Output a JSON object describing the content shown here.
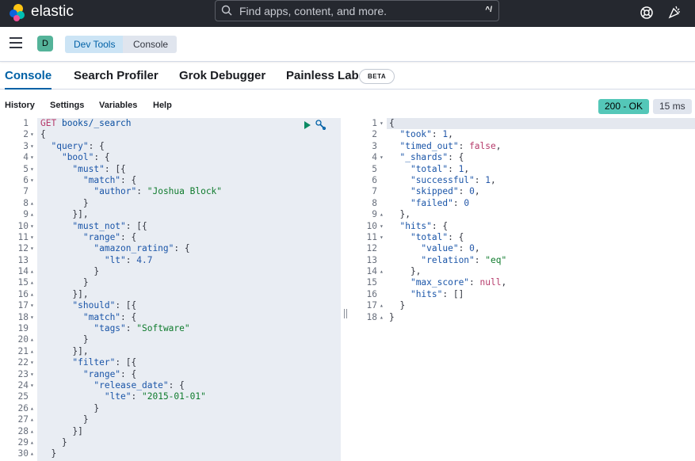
{
  "header": {
    "brand": "elastic",
    "search_placeholder": "Find apps, content, and more.",
    "search_shortcut": "^/"
  },
  "subheader": {
    "avatar_initial": "D",
    "breadcrumbs": [
      "Dev Tools",
      "Console"
    ]
  },
  "tabs": {
    "console": "Console",
    "profiler": "Search Profiler",
    "grok": "Grok Debugger",
    "painless": "Painless Lab",
    "beta": "BETA"
  },
  "toolbar": {
    "history": "History",
    "settings": "Settings",
    "variables": "Variables",
    "help": "Help",
    "status": "200 - OK",
    "time": "15 ms"
  },
  "editor_lines": [
    {
      "n": "1",
      "f": "",
      "t": "GET books/_search"
    },
    {
      "n": "2",
      "f": "▾",
      "t": "{"
    },
    {
      "n": "3",
      "f": "▾",
      "t": "  \"query\": {"
    },
    {
      "n": "4",
      "f": "▾",
      "t": "    \"bool\": {"
    },
    {
      "n": "5",
      "f": "▾",
      "t": "      \"must\": [{"
    },
    {
      "n": "6",
      "f": "▾",
      "t": "        \"match\": {"
    },
    {
      "n": "7",
      "f": "",
      "t": "          \"author\": \"Joshua Block\""
    },
    {
      "n": "8",
      "f": "▴",
      "t": "        }"
    },
    {
      "n": "9",
      "f": "▴",
      "t": "      }],"
    },
    {
      "n": "10",
      "f": "▾",
      "t": "      \"must_not\": [{"
    },
    {
      "n": "11",
      "f": "▾",
      "t": "        \"range\": {"
    },
    {
      "n": "12",
      "f": "▾",
      "t": "          \"amazon_rating\": {"
    },
    {
      "n": "13",
      "f": "",
      "t": "            \"lt\": 4.7"
    },
    {
      "n": "14",
      "f": "▴",
      "t": "          }"
    },
    {
      "n": "15",
      "f": "▴",
      "t": "        }"
    },
    {
      "n": "16",
      "f": "▴",
      "t": "      }],"
    },
    {
      "n": "17",
      "f": "▾",
      "t": "      \"should\": [{"
    },
    {
      "n": "18",
      "f": "▾",
      "t": "        \"match\": {"
    },
    {
      "n": "19",
      "f": "",
      "t": "          \"tags\": \"Software\""
    },
    {
      "n": "20",
      "f": "▴",
      "t": "        }"
    },
    {
      "n": "21",
      "f": "▴",
      "t": "      }],"
    },
    {
      "n": "22",
      "f": "▾",
      "t": "      \"filter\": [{"
    },
    {
      "n": "23",
      "f": "▾",
      "t": "        \"range\": {"
    },
    {
      "n": "24",
      "f": "▾",
      "t": "          \"release_date\": {"
    },
    {
      "n": "25",
      "f": "",
      "t": "            \"lte\": \"2015-01-01\""
    },
    {
      "n": "26",
      "f": "▴",
      "t": "          }"
    },
    {
      "n": "27",
      "f": "▴",
      "t": "        }"
    },
    {
      "n": "28",
      "f": "▴",
      "t": "      }]"
    },
    {
      "n": "29",
      "f": "▴",
      "t": "    }"
    },
    {
      "n": "30",
      "f": "▴",
      "t": "  }"
    }
  ],
  "output_lines": [
    {
      "n": "1",
      "f": "▾",
      "t": "{"
    },
    {
      "n": "2",
      "f": "",
      "t": "  \"took\": 1,"
    },
    {
      "n": "3",
      "f": "",
      "t": "  \"timed_out\": false,"
    },
    {
      "n": "4",
      "f": "▾",
      "t": "  \"_shards\": {"
    },
    {
      "n": "5",
      "f": "",
      "t": "    \"total\": 1,"
    },
    {
      "n": "6",
      "f": "",
      "t": "    \"successful\": 1,"
    },
    {
      "n": "7",
      "f": "",
      "t": "    \"skipped\": 0,"
    },
    {
      "n": "8",
      "f": "",
      "t": "    \"failed\": 0"
    },
    {
      "n": "9",
      "f": "▴",
      "t": "  },"
    },
    {
      "n": "10",
      "f": "▾",
      "t": "  \"hits\": {"
    },
    {
      "n": "11",
      "f": "▾",
      "t": "    \"total\": {"
    },
    {
      "n": "12",
      "f": "",
      "t": "      \"value\": 0,"
    },
    {
      "n": "13",
      "f": "",
      "t": "      \"relation\": \"eq\""
    },
    {
      "n": "14",
      "f": "▴",
      "t": "    },"
    },
    {
      "n": "15",
      "f": "",
      "t": "    \"max_score\": null,"
    },
    {
      "n": "16",
      "f": "",
      "t": "    \"hits\": []"
    },
    {
      "n": "17",
      "f": "▴",
      "t": "  }"
    },
    {
      "n": "18",
      "f": "▴",
      "t": "}"
    }
  ]
}
